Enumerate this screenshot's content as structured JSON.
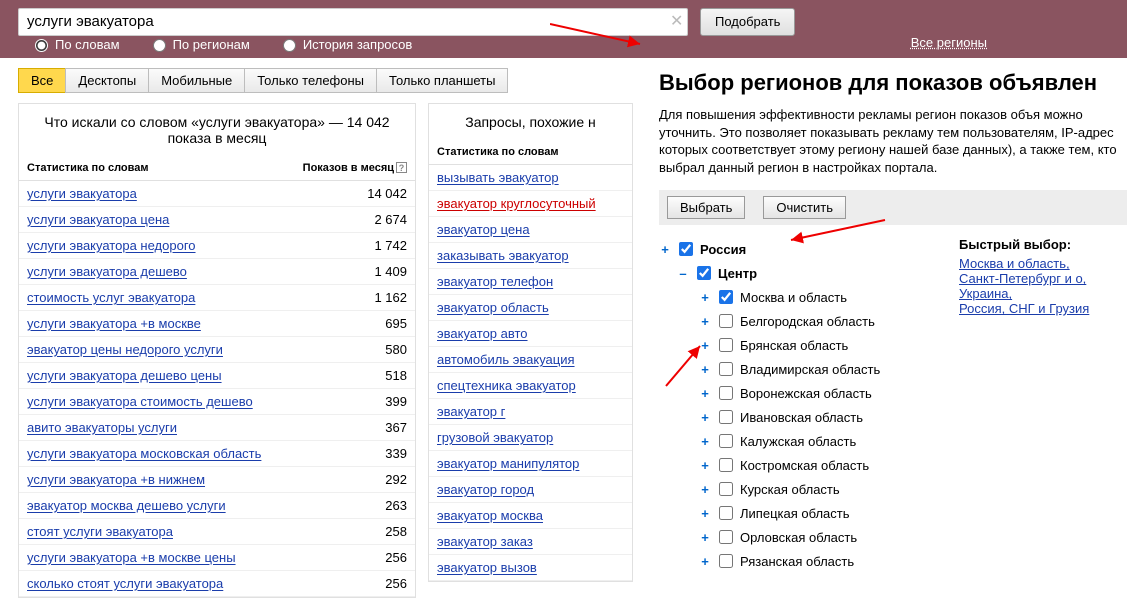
{
  "search": {
    "value": "услуги эвакуатора",
    "submit": "Подобрать"
  },
  "tabs": {
    "by_words": "По словам",
    "by_regions": "По регионам",
    "history": "История запросов"
  },
  "region_link": "Все регионы",
  "device_filters": {
    "all": "Все",
    "desktop": "Десктопы",
    "mobile": "Мобильные",
    "phones": "Только телефоны",
    "tablets": "Только планшеты"
  },
  "left": {
    "title": "Что искали со словом «услуги эвакуатора» — 14 042 показа в месяц",
    "th_words": "Статистика по словам",
    "th_count": "Показов в месяц",
    "rows": [
      {
        "q": "услуги эвакуатора",
        "n": "14 042"
      },
      {
        "q": "услуги эвакуатора цена",
        "n": "2 674"
      },
      {
        "q": "услуги эвакуатора недорого",
        "n": "1 742"
      },
      {
        "q": "услуги эвакуатора дешево",
        "n": "1 409"
      },
      {
        "q": "стоимость услуг эвакуатора",
        "n": "1 162"
      },
      {
        "q": "услуги эвакуатора +в москве",
        "n": "695"
      },
      {
        "q": "эвакуатор цены недорого услуги",
        "n": "580"
      },
      {
        "q": "услуги эвакуатора дешево цены",
        "n": "518"
      },
      {
        "q": "услуги эвакуатора стоимость дешево",
        "n": "399"
      },
      {
        "q": "авито эвакуаторы услуги",
        "n": "367"
      },
      {
        "q": "услуги эвакуатора московская область",
        "n": "339"
      },
      {
        "q": "услуги эвакуатора +в нижнем",
        "n": "292"
      },
      {
        "q": "эвакуатор москва дешево услуги",
        "n": "263"
      },
      {
        "q": "стоят услуги эвакуатора",
        "n": "258"
      },
      {
        "q": "услуги эвакуатора +в москве цены",
        "n": "256"
      },
      {
        "q": "сколько стоят услуги эвакуатора",
        "n": "256"
      }
    ]
  },
  "right_col": {
    "title": "Запросы, похожие н",
    "th_words": "Статистика по словам",
    "rows": [
      {
        "q": "вызывать эвакуатор",
        "red": false
      },
      {
        "q": "эвакуатор круглосуточный",
        "red": true
      },
      {
        "q": "эвакуатор цена",
        "red": false
      },
      {
        "q": "заказывать эвакуатор",
        "red": false
      },
      {
        "q": "эвакуатор телефон",
        "red": false
      },
      {
        "q": "эвакуатор область",
        "red": false
      },
      {
        "q": "эвакуатор авто",
        "red": false
      },
      {
        "q": "автомобиль эвакуация",
        "red": false
      },
      {
        "q": "спецтехника эвакуатор",
        "red": false
      },
      {
        "q": "эвакуатор г",
        "red": false
      },
      {
        "q": "грузовой эвакуатор",
        "red": false
      },
      {
        "q": "эвакуатор манипулятор",
        "red": false
      },
      {
        "q": "эвакуатор город",
        "red": false
      },
      {
        "q": "эвакуатор москва",
        "red": false
      },
      {
        "q": "эвакуатор заказ",
        "red": false
      },
      {
        "q": "эвакуатор вызов",
        "red": false
      }
    ]
  },
  "popup": {
    "title": "Выбор регионов для показов объявлен",
    "desc": "Для повышения эффективности рекламы регион показов объя можно уточнить. Это позволяет показывать рекламу тем пользователям, IP-адрес которых соответствует этому региону нашей базе данных), а также тем, кто выбрал данный регион в настройках портала.",
    "btn_select": "Выбрать",
    "btn_clear": "Очистить",
    "russia": "Россия",
    "center": "Центр",
    "regions": [
      {
        "name": "Москва и область",
        "checked": true
      },
      {
        "name": "Белгородская область",
        "checked": false
      },
      {
        "name": "Брянская область",
        "checked": false
      },
      {
        "name": "Владимирская область",
        "checked": false
      },
      {
        "name": "Воронежская область",
        "checked": false
      },
      {
        "name": "Ивановская область",
        "checked": false
      },
      {
        "name": "Калужская область",
        "checked": false
      },
      {
        "name": "Костромская область",
        "checked": false
      },
      {
        "name": "Курская область",
        "checked": false
      },
      {
        "name": "Липецкая область",
        "checked": false
      },
      {
        "name": "Орловская область",
        "checked": false
      },
      {
        "name": "Рязанская область",
        "checked": false
      }
    ],
    "quick_title": "Быстрый выбор:",
    "quick_links": [
      "Москва и область",
      "Санкт-Петербург и о",
      "Украина",
      "Россия, СНГ и Грузия"
    ]
  }
}
